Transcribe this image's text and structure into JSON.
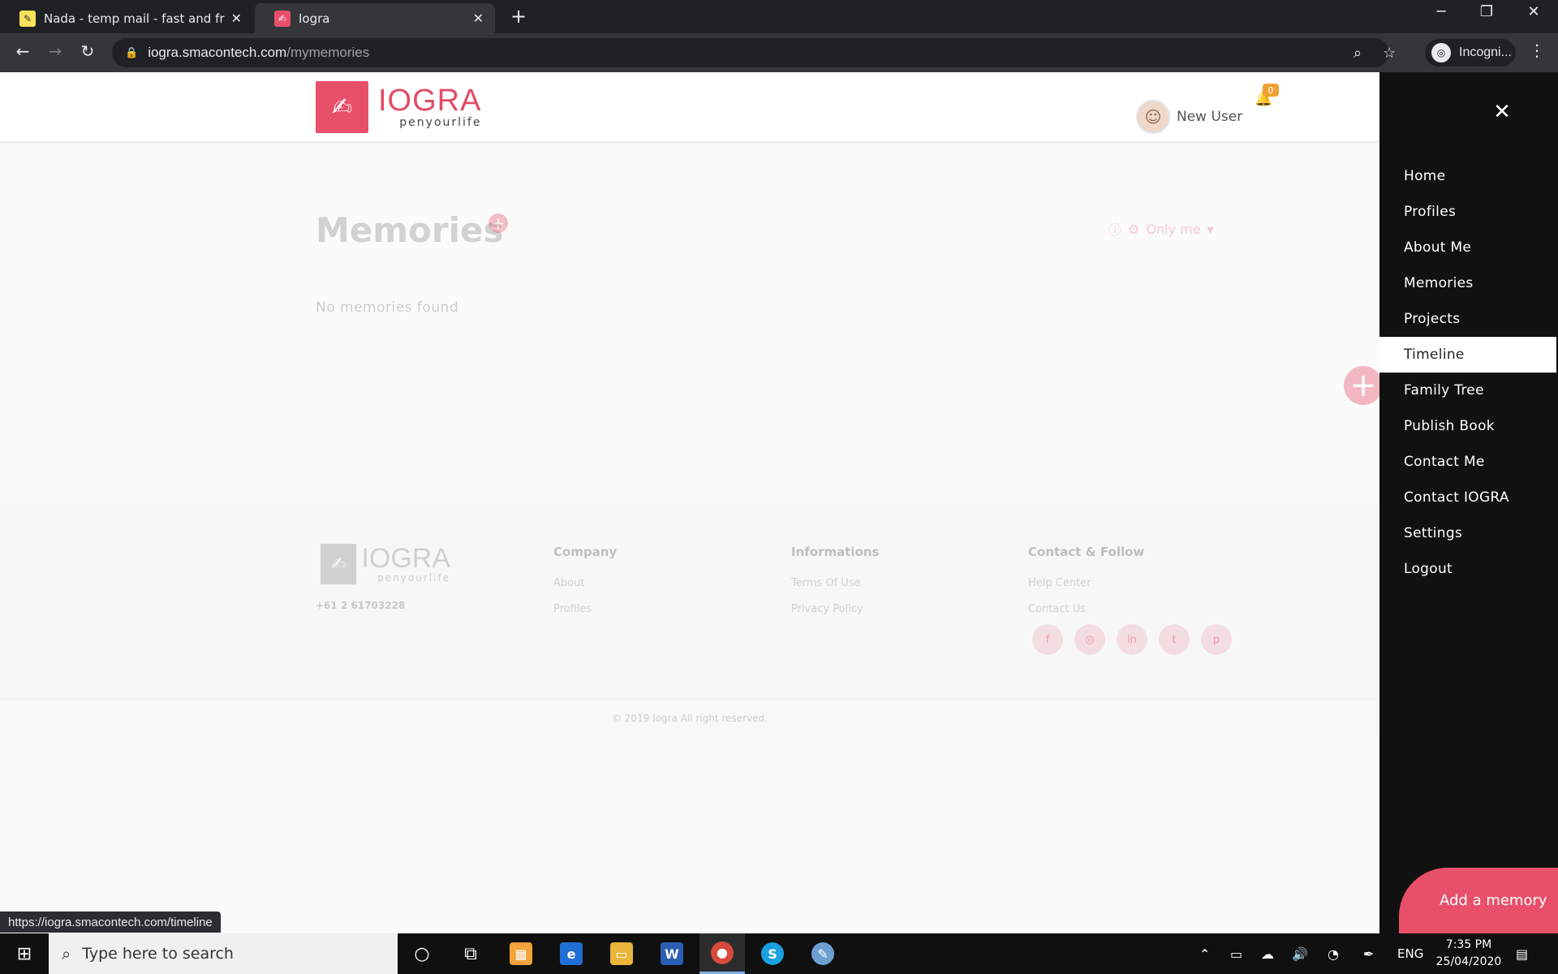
{
  "browser": {
    "tabs": [
      {
        "title": "Nada - temp mail - fast and free",
        "active": false
      },
      {
        "title": "Iogra",
        "active": true
      }
    ],
    "url_domain": "iogra.smacontech.com",
    "url_path": "/mymemories",
    "profile_label": "Incogni...",
    "status_url": "https://iogra.smacontech.com/timeline"
  },
  "header": {
    "logo_brand": "IOGRA",
    "logo_tagline": "penyourlife",
    "user_name": "New User",
    "notification_count": "0"
  },
  "main": {
    "title": "Memories",
    "privacy_label": "Only me",
    "empty_message": "No memories found"
  },
  "footer": {
    "logo_brand": "IOGRA",
    "logo_tagline": "penyourlife",
    "phone": "+61 2 61703228",
    "columns": [
      {
        "heading": "Company",
        "links": [
          "About",
          "Profiles"
        ]
      },
      {
        "heading": "Informations",
        "links": [
          "Terms Of Use",
          "Privacy Policy"
        ]
      },
      {
        "heading": "Contact & Follow",
        "links": [
          "Help Center",
          "Contact Us"
        ]
      }
    ],
    "copyright": "© 2019 Iogra All right reserved."
  },
  "side_menu": {
    "items": [
      {
        "label": "Home"
      },
      {
        "label": "Profiles"
      },
      {
        "label": "About Me"
      },
      {
        "label": "Memories"
      },
      {
        "label": "Projects"
      },
      {
        "label": "Timeline"
      },
      {
        "label": "Family Tree"
      },
      {
        "label": "Publish Book"
      },
      {
        "label": "Contact Me"
      },
      {
        "label": "Contact IOGRA"
      },
      {
        "label": "Settings"
      },
      {
        "label": "Logout"
      }
    ],
    "active_item": "Timeline",
    "add_button_label": "Add a memory"
  },
  "taskbar": {
    "search_placeholder": "Type here to search",
    "language": "ENG",
    "time": "7:35 PM",
    "date": "25/04/2020"
  },
  "colors": {
    "brand": "#e8506a",
    "menu_bg": "#111111",
    "badge": "#f0a030"
  }
}
